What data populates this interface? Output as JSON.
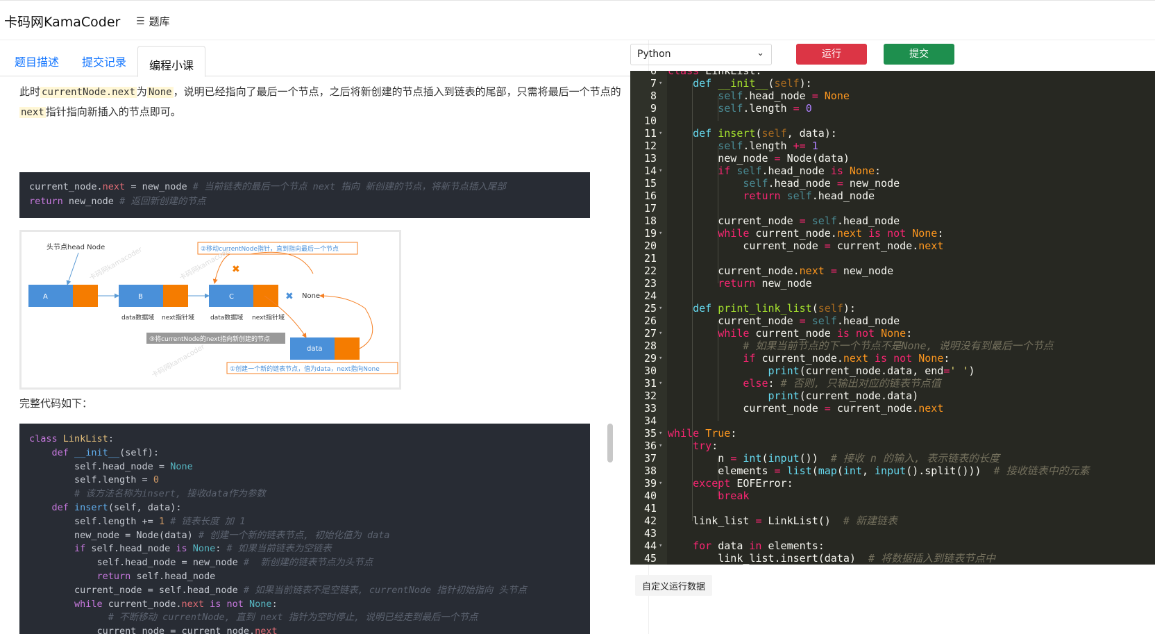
{
  "header": {
    "brand": "卡码网KamaCoder",
    "menu_label": "题库"
  },
  "tabs": [
    "题目描述",
    "提交记录",
    "编程小课"
  ],
  "article": {
    "para1_a": "此时",
    "para1_code1": "currentNode.next",
    "para1_b": "为",
    "para1_code2": "None",
    "para1_c": "，说明已经指向了最后一个节点，之后将新创建的节点插入到链表的尾部，只需将最后一个节点的",
    "para1_code3": "next",
    "para1_d": "指针指向新插入的节点即可。",
    "done_label": "完整代码如下："
  },
  "figure": {
    "head_label": "头节点head Node",
    "step2": "②移动currentNode指针，直到指向最后一个节点",
    "step3": "③将currentNode的next指向新创建的节点",
    "step1": "①创建一个新的链表节点，值为data，next指向None",
    "nodeA": "A",
    "nodeB": "B",
    "nodeC": "C",
    "nodeData": "data",
    "none_label": "None",
    "data_field": "data数据域",
    "next_field": "next指针域",
    "watermark": "卡码网kamacoder"
  },
  "toolbar": {
    "language": "Python",
    "run": "运行",
    "submit": "提交",
    "custom_run": "自定义运行数据"
  },
  "colors": {
    "run": "#dc3545",
    "submit": "#1e8f4e",
    "link": "#1677ff",
    "editor_bg": "#272822"
  }
}
